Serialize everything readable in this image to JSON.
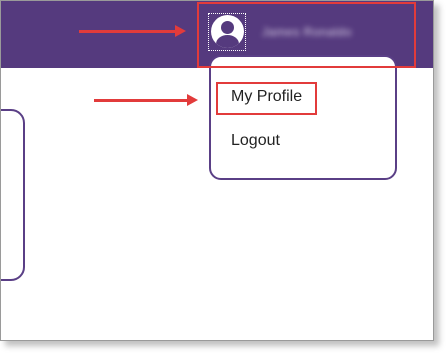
{
  "header": {
    "user_name": "James Ronaldo",
    "avatar_icon": "user-avatar-icon"
  },
  "dropdown": {
    "items": [
      {
        "label": "My Profile"
      },
      {
        "label": "Logout"
      }
    ]
  },
  "colors": {
    "topbar": "#553a7e",
    "accent_border": "#5a3f86",
    "annotation_red": "#e23b3b"
  }
}
